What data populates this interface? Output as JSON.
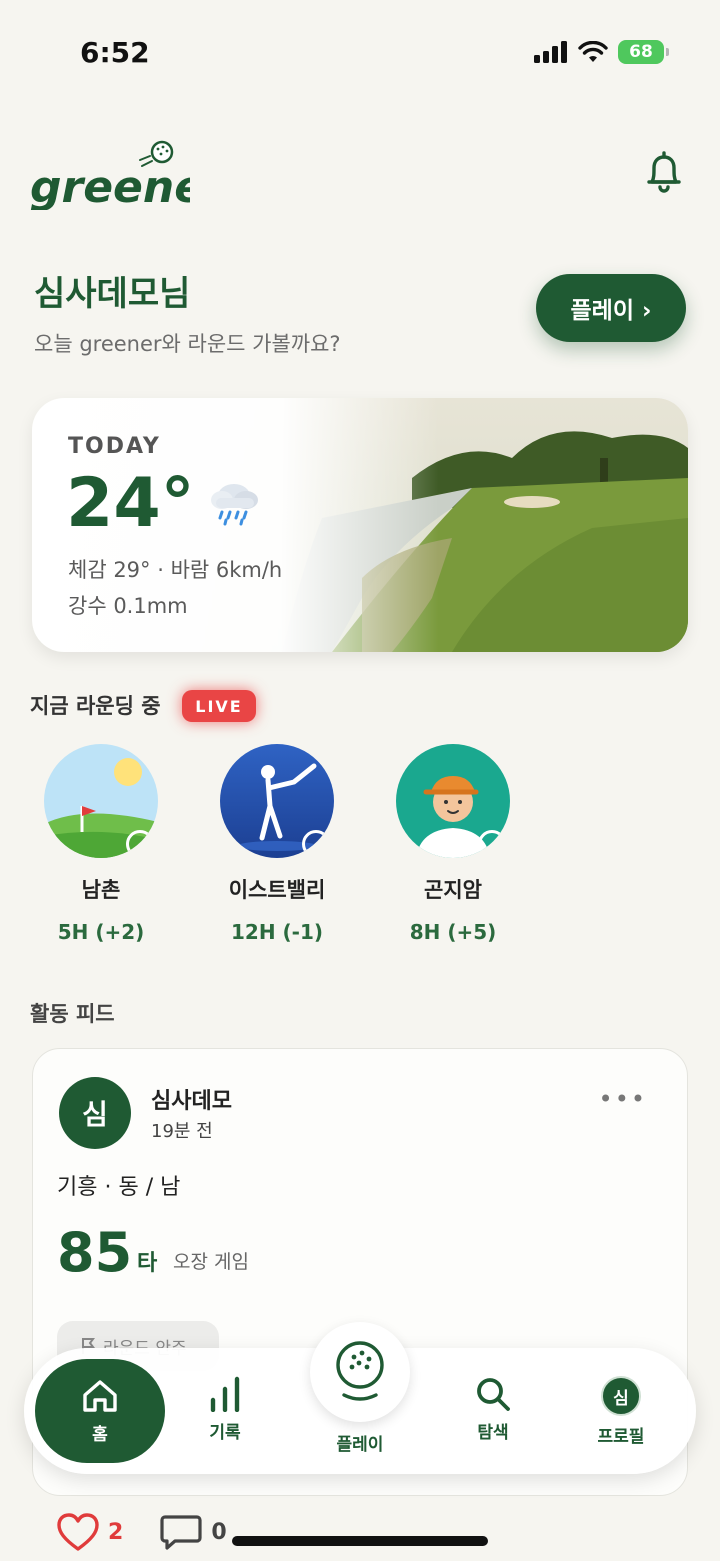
{
  "status_bar": {
    "time": "6:52",
    "battery": "68"
  },
  "header": {
    "logo_text": "greener"
  },
  "greeting": {
    "name": "심사데모님",
    "subtitle": "오늘 greener와 라운드 가볼까요?",
    "play_button": "플레이 ›"
  },
  "weather": {
    "label": "TODAY",
    "temp": "24°",
    "feels": "체감 29° · 바람 6km/h",
    "precip": "강수 0.1mm"
  },
  "live": {
    "title": "지금 라운딩 중",
    "badge": "LIVE",
    "players": [
      {
        "name": "남촌",
        "score": "5H (+2)"
      },
      {
        "name": "이스트밸리",
        "score": "12H (-1)"
      },
      {
        "name": "곤지암",
        "score": "8H (+5)"
      }
    ]
  },
  "feed": {
    "title": "활동 피드",
    "post": {
      "avatar": "심",
      "user": "심사데모",
      "time": "19분 전",
      "course": "기흥 · 동 / 남",
      "score": "85",
      "unit": "타",
      "mode": "오장 게임",
      "chip": "라운드 안주",
      "likes": "2",
      "comments": "0"
    }
  },
  "tabbar": {
    "home": "홈",
    "records": "기록",
    "play": "플레이",
    "explore": "탐색",
    "profile": "프로필",
    "profile_avatar": "심"
  },
  "colors": {
    "brand": "#1f5a33",
    "live": "#e94545",
    "like": "#e03b3b",
    "background": "#f6f5f0"
  }
}
